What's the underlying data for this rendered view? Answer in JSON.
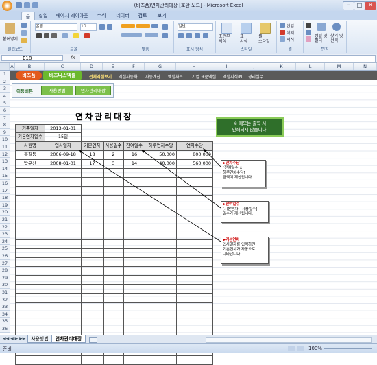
{
  "window": {
    "title": "(비즈폼)연차관리대장  [호환 모드] - Microsoft Excel",
    "min": "─",
    "max": "□",
    "close": "✕"
  },
  "ribbon_tabs": [
    "홈",
    "삽입",
    "페이지 레이아웃",
    "수식",
    "데이터",
    "검토",
    "보기"
  ],
  "ribbon": {
    "paste": "붙여넣기",
    "font_name": "굴림",
    "font_size": "10",
    "number_format": "일반",
    "conditional": "조건부\n서식",
    "table_format": "표\n서식",
    "cell_style": "셀\n스타일",
    "insert": "삽입",
    "delete": "삭제",
    "format": "서식",
    "sort": "정렬 및\n필터",
    "find": "찾기 및\n선택",
    "groups": [
      "클립보드",
      "글꼴",
      "맞춤",
      "표시 형식",
      "스타일",
      "셀",
      "편집"
    ]
  },
  "formula_bar": {
    "name_box": "E18",
    "fx": "fx",
    "value": ""
  },
  "columns": [
    "A",
    "B",
    "C",
    "D",
    "E",
    "F",
    "G",
    "H",
    "I",
    "J",
    "K",
    "L",
    "M",
    "N"
  ],
  "rows": [
    "1",
    "2",
    "3",
    "4",
    "5",
    "6",
    "7",
    "8",
    "9",
    "10",
    "11",
    "12",
    "13",
    "14",
    "15",
    "16",
    "17",
    "18",
    "19",
    "20",
    "21",
    "22",
    "23",
    "24",
    "25",
    "26",
    "27",
    "28",
    "29",
    "30",
    "31",
    "32",
    "33",
    "34",
    "35",
    "36"
  ],
  "banner": {
    "logo1": "비즈폼",
    "logo2": "비즈니스엑셀",
    "menu": [
      "전체엑셀보기",
      "엑셀자동화",
      "자동계산",
      "엑셀차트",
      "기업 표준엑셀",
      "엑셀지식iN",
      "경리실무"
    ]
  },
  "nav": {
    "label": "이동버튼",
    "btn1": "사용방법",
    "btn2": "연차관리대장"
  },
  "sheet_title": "연차관리대장",
  "info": {
    "base_date_label": "기준일자",
    "base_date": "2013-01-01",
    "base_days_label": "기본연차일수",
    "base_days": "15일"
  },
  "table": {
    "headers": [
      "사원명",
      "입사일자",
      "기본연차",
      "사용일수",
      "잔여일수",
      "하루연차수당",
      "연차수당"
    ],
    "rows": [
      [
        "홍길동",
        "2006-09-18",
        "18",
        "2",
        "16",
        "50,000",
        "800,000"
      ],
      [
        "박우산",
        "2008-01-01",
        "17",
        "3",
        "14",
        "40,000",
        "560,000"
      ]
    ]
  },
  "green_note": "※ 메모는 출력 시\n인쇄되지 않습니다.",
  "notes": [
    {
      "title": "▶연차수당",
      "body": "[잔여일수 ×\n하루연차수당]\n금액이 계산됩니다."
    },
    {
      "title": "▶잔여일수",
      "body": "[기본연차 - 사용일수]\n일수가 계산됩니다."
    },
    {
      "title": "▶기본연차",
      "body": "입사일자를 입력하면\n기본연차가 자동으로\n나타납니다."
    }
  ],
  "sheet_tabs": [
    "사용방법",
    "연차관리대장"
  ],
  "status": {
    "ready": "준비",
    "zoom": "100%"
  }
}
